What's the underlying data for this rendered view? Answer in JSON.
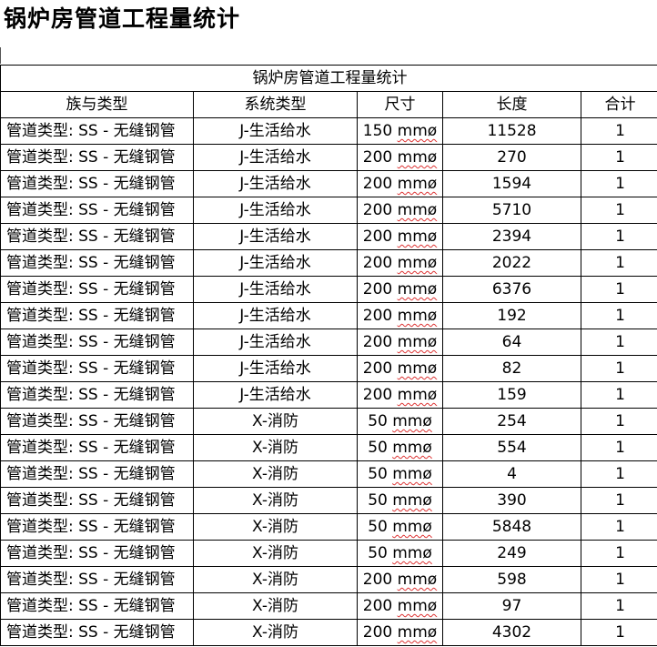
{
  "page": {
    "title": "锅炉房管道工程量统计"
  },
  "table": {
    "caption": "锅炉房管道工程量统计",
    "headers": [
      "族与类型",
      "系统类型",
      "尺寸",
      "长度",
      "合计"
    ],
    "rows": [
      {
        "family": "管道类型: SS -  无缝钢管",
        "system": "J-生活给水",
        "size_num": "150 ",
        "size_unit": "mmø",
        "length": "11528",
        "count": "1"
      },
      {
        "family": "管道类型: SS -  无缝钢管",
        "system": "J-生活给水",
        "size_num": "200 ",
        "size_unit": "mmø",
        "length": "270",
        "count": "1"
      },
      {
        "family": "管道类型: SS -  无缝钢管",
        "system": "J-生活给水",
        "size_num": "200 ",
        "size_unit": "mmø",
        "length": "1594",
        "count": "1"
      },
      {
        "family": "管道类型: SS -  无缝钢管",
        "system": "J-生活给水",
        "size_num": "200 ",
        "size_unit": "mmø",
        "length": "5710",
        "count": "1"
      },
      {
        "family": "管道类型: SS -  无缝钢管",
        "system": "J-生活给水",
        "size_num": "200 ",
        "size_unit": "mmø",
        "length": "2394",
        "count": "1"
      },
      {
        "family": "管道类型: SS -  无缝钢管",
        "system": "J-生活给水",
        "size_num": "200 ",
        "size_unit": "mmø",
        "length": "2022",
        "count": "1"
      },
      {
        "family": "管道类型: SS -  无缝钢管",
        "system": "J-生活给水",
        "size_num": "200 ",
        "size_unit": "mmø",
        "length": "6376",
        "count": "1"
      },
      {
        "family": "管道类型: SS -  无缝钢管",
        "system": "J-生活给水",
        "size_num": "200 ",
        "size_unit": "mmø",
        "length": "192",
        "count": "1"
      },
      {
        "family": "管道类型: SS -  无缝钢管",
        "system": "J-生活给水",
        "size_num": "200 ",
        "size_unit": "mmø",
        "length": "64",
        "count": "1"
      },
      {
        "family": "管道类型: SS -  无缝钢管",
        "system": "J-生活给水",
        "size_num": "200 ",
        "size_unit": "mmø",
        "length": "82",
        "count": "1"
      },
      {
        "family": "管道类型: SS -  无缝钢管",
        "system": "J-生活给水",
        "size_num": "200 ",
        "size_unit": "mmø",
        "length": "159",
        "count": "1"
      },
      {
        "family": "管道类型: SS -  无缝钢管",
        "system": "X-消防",
        "size_num": "50 ",
        "size_unit": "mmø",
        "length": "254",
        "count": "1"
      },
      {
        "family": "管道类型: SS -  无缝钢管",
        "system": "X-消防",
        "size_num": "50 ",
        "size_unit": "mmø",
        "length": "554",
        "count": "1"
      },
      {
        "family": "管道类型: SS -  无缝钢管",
        "system": "X-消防",
        "size_num": "50 ",
        "size_unit": "mmø",
        "length": "4",
        "count": "1"
      },
      {
        "family": "管道类型: SS -  无缝钢管",
        "system": "X-消防",
        "size_num": "50 ",
        "size_unit": "mmø",
        "length": "390",
        "count": "1"
      },
      {
        "family": "管道类型: SS -  无缝钢管",
        "system": "X-消防",
        "size_num": "50 ",
        "size_unit": "mmø",
        "length": "5848",
        "count": "1"
      },
      {
        "family": "管道类型: SS -  无缝钢管",
        "system": "X-消防",
        "size_num": "50 ",
        "size_unit": "mmø",
        "length": "249",
        "count": "1"
      },
      {
        "family": "管道类型: SS -  无缝钢管",
        "system": "X-消防",
        "size_num": "200 ",
        "size_unit": "mmø",
        "length": "598",
        "count": "1"
      },
      {
        "family": "管道类型: SS -  无缝钢管",
        "system": "X-消防",
        "size_num": "200 ",
        "size_unit": "mmø",
        "length": "97",
        "count": "1"
      },
      {
        "family": "管道类型: SS -  无缝钢管",
        "system": "X-消防",
        "size_num": "200 ",
        "size_unit": "mmø",
        "length": "4302",
        "count": "1"
      }
    ]
  }
}
